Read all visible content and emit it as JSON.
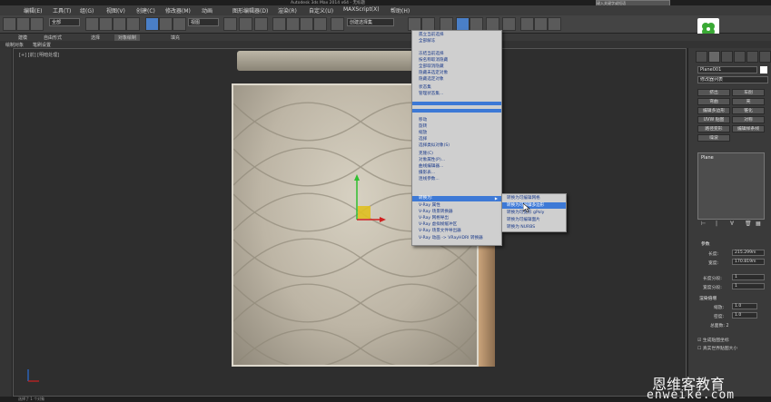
{
  "window": {
    "title": "Autodesk 3ds Max 2014 x64 - 无标题",
    "search_placeholder": "键入关键字或短语"
  },
  "menu": [
    "编辑(E)",
    "工具(T)",
    "组(G)",
    "视图(V)",
    "创建(C)",
    "修改器(M)",
    "动画",
    "图形编辑器(D)",
    "渲染(R)",
    "自定义(U)",
    "MAXScript(X)",
    "帮助(H)"
  ],
  "toolbar": {
    "filter_dropdown": "全部",
    "view_dropdown": "视图",
    "selection_set": "创建选择集"
  },
  "ribbon": {
    "tabs": [
      "建模",
      "自由形式",
      "选择",
      "对象绘制",
      "填充"
    ],
    "selected": "对象绘制",
    "sub_tabs": [
      "绘制对象",
      "笔刷设置"
    ]
  },
  "viewport": {
    "label": "[+] [前] [明暗处理]"
  },
  "context_menu": {
    "items": [
      {
        "label": "孤立当前选择",
        "type": "normal"
      },
      {
        "label": "全部解冻",
        "type": "normal"
      },
      {
        "label": "冻结当前选择",
        "type": "normal"
      },
      {
        "label": "按名称取消隐藏",
        "type": "normal"
      },
      {
        "label": "全部取消隐藏",
        "type": "normal"
      },
      {
        "label": "隐藏未选定对象",
        "type": "normal"
      },
      {
        "label": "隐藏选定对象",
        "type": "normal"
      },
      {
        "label": "状态集",
        "type": "normal"
      },
      {
        "label": "管理状态集...",
        "type": "normal"
      },
      {
        "label": "移动",
        "type": "normal"
      },
      {
        "label": "旋转",
        "type": "normal"
      },
      {
        "label": "缩放",
        "type": "normal"
      },
      {
        "label": "选择",
        "type": "normal"
      },
      {
        "label": "选择类似对象(S)",
        "type": "normal"
      },
      {
        "label": "克隆(C)",
        "type": "normal"
      },
      {
        "label": "对象属性(P)...",
        "type": "normal"
      },
      {
        "label": "曲线编辑器...",
        "type": "normal"
      },
      {
        "label": "摄影表...",
        "type": "normal"
      },
      {
        "label": "连线参数...",
        "type": "normal"
      },
      {
        "label": "转换为:",
        "type": "highlight"
      },
      {
        "label": "V-Ray 属性",
        "type": "normal"
      },
      {
        "label": "V-Ray 场景转换器",
        "type": "normal"
      },
      {
        "label": "V-Ray 网格导出",
        "type": "normal"
      },
      {
        "label": "V-Ray 虚拟帧缓冲区",
        "type": "normal"
      },
      {
        "label": "V-Ray 场景文件导出器",
        "type": "normal"
      },
      {
        "label": "V-Ray 动画 -> VRayHDRI 转换器",
        "type": "normal"
      }
    ]
  },
  "submenu": {
    "items": [
      {
        "label": "转换为可编辑网格",
        "highlight": false
      },
      {
        "label": "转换为可编辑多边形",
        "highlight": true
      },
      {
        "label": "转换为可变形 gPoly",
        "highlight": false
      },
      {
        "label": "转换为可编辑面片",
        "highlight": false
      },
      {
        "label": "转换为 NURBS",
        "highlight": false
      }
    ]
  },
  "command_panel": {
    "object_name": "Plane001",
    "modifier_list": "修改器列表",
    "buttons": [
      "挤出",
      "车削",
      "弯曲",
      "壳",
      "编辑多边形",
      "锥化",
      "UVW 贴图",
      "对称",
      "路径变形",
      "编辑样条线",
      "噪波"
    ],
    "stack_item": "Plane",
    "params_title": "参数",
    "length_label": "长度:",
    "length_value": "215.299m",
    "width_label": "宽度:",
    "width_value": "170.819m",
    "length_segs_label": "长度分段:",
    "length_segs_value": "1",
    "width_segs_label": "宽度分段:",
    "width_segs_value": "1",
    "render_mult_title": "渲染倍增",
    "scale_label": "缩放:",
    "scale_value": "1.0",
    "density_label": "密度:",
    "density_value": "1.0",
    "total_faces_label": "总面数: 2",
    "gen_mapping": "生成贴图坐标",
    "real_world": "真实世界贴图大小"
  },
  "status": {
    "text": "选择了 1 个对象"
  },
  "watermark": {
    "cn": "恩维客教育",
    "en": "enweike.com"
  },
  "colors": {
    "highlight": "#3d79d6",
    "background": "#2b2b2b"
  }
}
